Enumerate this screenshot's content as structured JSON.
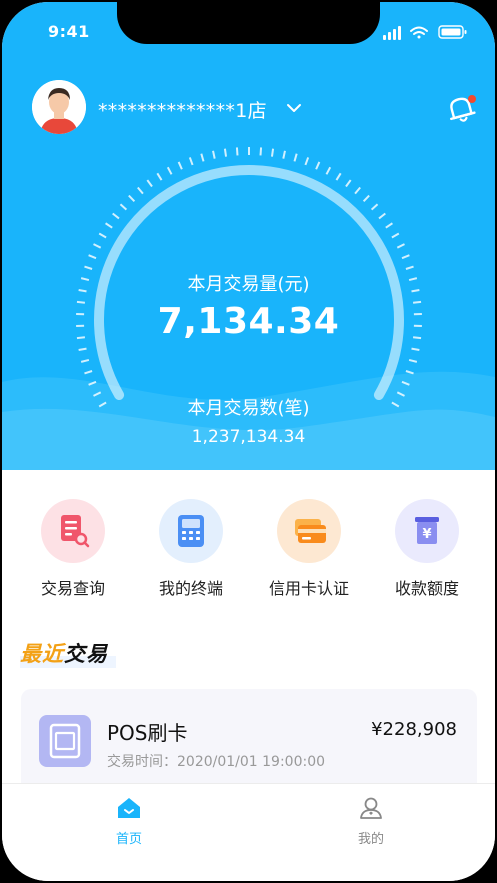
{
  "status_bar": {
    "time": "9:41"
  },
  "header": {
    "store_name": "**************1店"
  },
  "stats": {
    "monthly_amount_label": "本月交易量(元)",
    "monthly_amount_value": "7,134.34",
    "monthly_count_label": "本月交易数(笔)",
    "monthly_count_value": "1,237,134.34"
  },
  "quick_actions": [
    {
      "label": "交易查询",
      "icon": "receipt-search-icon",
      "color": "#fde1e5"
    },
    {
      "label": "我的终端",
      "icon": "pos-terminal-icon",
      "color": "#e3effd"
    },
    {
      "label": "信用卡认证",
      "icon": "credit-card-icon",
      "color": "#fde8d2"
    },
    {
      "label": "收款额度",
      "icon": "yuan-box-icon",
      "color": "#eaeafd"
    }
  ],
  "recent": {
    "title_accent": "最近",
    "title_rest": "交易",
    "items": [
      {
        "title": "POS刷卡",
        "amount": "¥228,908",
        "time": "交易时间：2020/01/01 19:00:00"
      }
    ]
  },
  "tabbar": {
    "tabs": [
      {
        "label": "首页",
        "active": true
      },
      {
        "label": "我的",
        "active": false
      }
    ]
  },
  "colors": {
    "primary": "#19b4fb",
    "accent": "#f3a116",
    "active_tab": "#19b4fb",
    "inactive_tab": "#888888"
  }
}
